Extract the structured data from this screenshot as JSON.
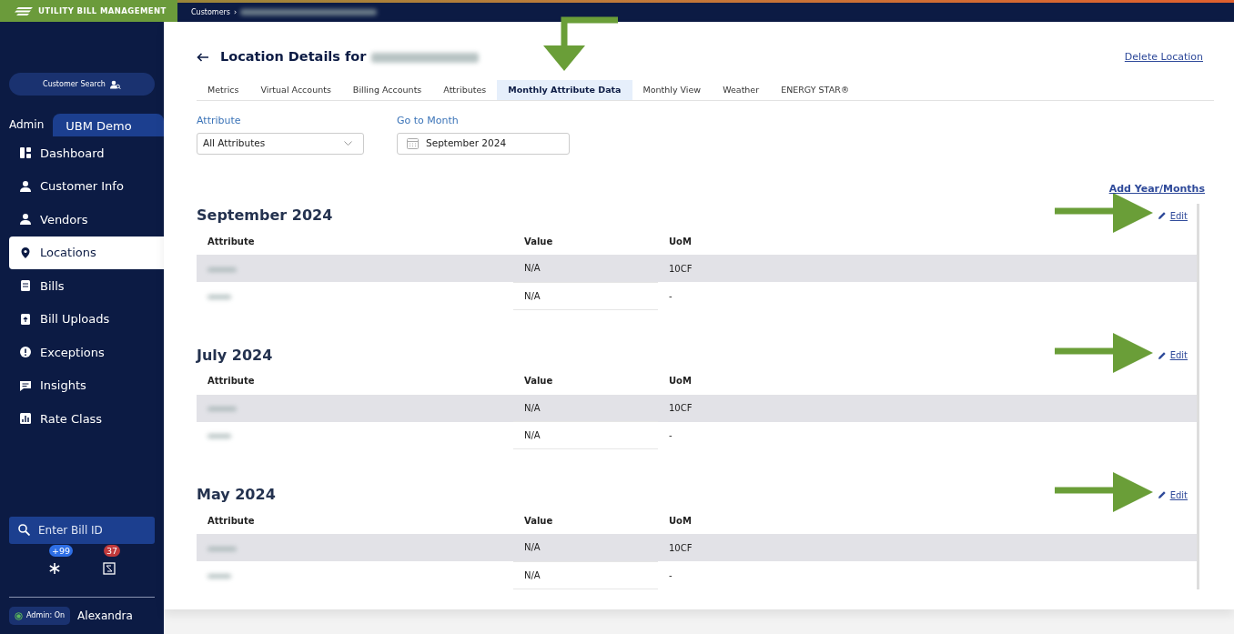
{
  "app": {
    "title": "UTILITY BILL MANAGEMENT"
  },
  "breadcrumb": [
    "Customers",
    "›"
  ],
  "sidebar": {
    "customer_search": "Customer Search",
    "tabs": [
      {
        "label": "Admin",
        "selected": false
      },
      {
        "label": "UBM Demo",
        "selected": true
      }
    ],
    "items": [
      {
        "label": "Dashboard",
        "selected": false
      },
      {
        "label": "Customer Info",
        "selected": false
      },
      {
        "label": "Vendors",
        "selected": false
      },
      {
        "label": "Locations",
        "selected": true
      },
      {
        "label": "Bills",
        "selected": false
      },
      {
        "label": "Bill Uploads",
        "selected": false
      },
      {
        "label": "Exceptions",
        "selected": false
      },
      {
        "label": "Insights",
        "selected": false
      },
      {
        "label": "Rate Class",
        "selected": false
      }
    ],
    "bill_search": {
      "placeholder": "Enter Bill ID"
    },
    "notifications": [
      {
        "count": "+99",
        "color": "#2e6fe6"
      },
      {
        "count": "37",
        "color": "#c0393b"
      }
    ],
    "admin": {
      "label": "Admin: On",
      "on": true
    },
    "user": "Alexandra"
  },
  "page": {
    "title": "Location Details for",
    "delete_link": "Delete Location",
    "tabs": [
      {
        "label": "Metrics",
        "selected": false,
        "marked": false
      },
      {
        "label": "Virtual Accounts",
        "selected": false,
        "marked": false
      },
      {
        "label": "Billing Accounts",
        "selected": false,
        "marked": false
      },
      {
        "label": "Attributes",
        "selected": false,
        "marked": false
      },
      {
        "label": "Monthly Attribute Data",
        "selected": true,
        "marked": true
      },
      {
        "label": "Monthly View",
        "selected": false,
        "marked": false
      },
      {
        "label": "Weather",
        "selected": false,
        "marked": false
      },
      {
        "label": "ENERGY STAR®",
        "selected": false,
        "marked": false
      }
    ],
    "filters": {
      "attribute_label": "Attribute",
      "attribute_value": "All Attributes",
      "month_label": "Go to Month",
      "month_value": "September 2024"
    },
    "add_link": "Add Year/Months",
    "months": [
      {
        "title": "September 2024",
        "edit": "Edit",
        "marked": true,
        "columns": [
          "Attribute",
          "Value",
          "UoM"
        ],
        "rows": [
          {
            "value": "N/A",
            "uom": "10CF",
            "highlighted": true
          },
          {
            "value": "N/A",
            "uom": "-",
            "highlighted": false
          }
        ]
      },
      {
        "title": "July 2024",
        "edit": "Edit",
        "marked": true,
        "columns": [
          "Attribute",
          "Value",
          "UoM"
        ],
        "rows": [
          {
            "value": "N/A",
            "uom": "10CF",
            "highlighted": true
          },
          {
            "value": "N/A",
            "uom": "-",
            "highlighted": false
          }
        ]
      },
      {
        "title": "May 2024",
        "edit": "Edit",
        "marked": true,
        "columns": [
          "Attribute",
          "Value",
          "UoM"
        ],
        "rows": [
          {
            "value": "N/A",
            "uom": "10CF",
            "highlighted": true
          },
          {
            "value": "N/A",
            "uom": "-",
            "highlighted": false
          }
        ]
      }
    ]
  }
}
